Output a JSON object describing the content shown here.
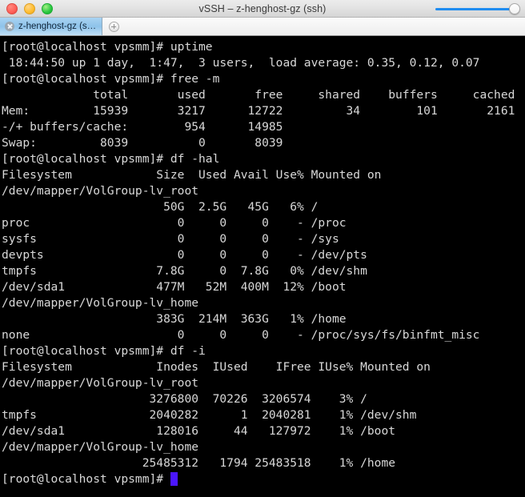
{
  "window": {
    "title": "vSSH – z-henghost-gz (ssh)",
    "traffic_lights": {
      "close_label": "close-window",
      "minimize_label": "minimize-window",
      "maximize_label": "maximize-window"
    },
    "slider": {
      "name": "title-slider",
      "value": 100,
      "accent_color": "#1f8cf0"
    }
  },
  "tabbar": {
    "tabs": [
      {
        "label": "z-henghost-gz (s…",
        "active": true,
        "close_icon": "close-icon"
      }
    ],
    "add_tab_icon": "plus-icon"
  },
  "terminal": {
    "background_color": "#000000",
    "text_color": "#d8d8d8",
    "cursor_color": "#4b16ff",
    "prompt": "[root@localhost vpsmm]# ",
    "lines": [
      "[root@localhost vpsmm]# uptime",
      " 18:44:50 up 1 day,  1:47,  3 users,  load average: 0.35, 0.12, 0.07",
      "[root@localhost vpsmm]# free -m",
      "             total       used       free     shared    buffers     cached",
      "Mem:         15939       3217      12722         34        101       2161",
      "-/+ buffers/cache:        954      14985",
      "Swap:         8039          0       8039",
      "[root@localhost vpsmm]# df -hal",
      "Filesystem            Size  Used Avail Use% Mounted on",
      "/dev/mapper/VolGroup-lv_root",
      "                       50G  2.5G   45G   6% /",
      "proc                     0     0     0    - /proc",
      "sysfs                    0     0     0    - /sys",
      "devpts                   0     0     0    - /dev/pts",
      "tmpfs                 7.8G     0  7.8G   0% /dev/shm",
      "/dev/sda1             477M   52M  400M  12% /boot",
      "/dev/mapper/VolGroup-lv_home",
      "                      383G  214M  363G   1% /home",
      "none                     0     0     0    - /proc/sys/fs/binfmt_misc",
      "[root@localhost vpsmm]# df -i",
      "Filesystem            Inodes  IUsed    IFree IUse% Mounted on",
      "/dev/mapper/VolGroup-lv_root",
      "                     3276800  70226  3206574    3% /",
      "tmpfs                2040282      1  2040281    1% /dev/shm",
      "/dev/sda1             128016     44   127972    1% /boot",
      "/dev/mapper/VolGroup-lv_home",
      "                    25485312   1794 25483518    1% /home"
    ],
    "final_prompt": "[root@localhost vpsmm]# "
  }
}
